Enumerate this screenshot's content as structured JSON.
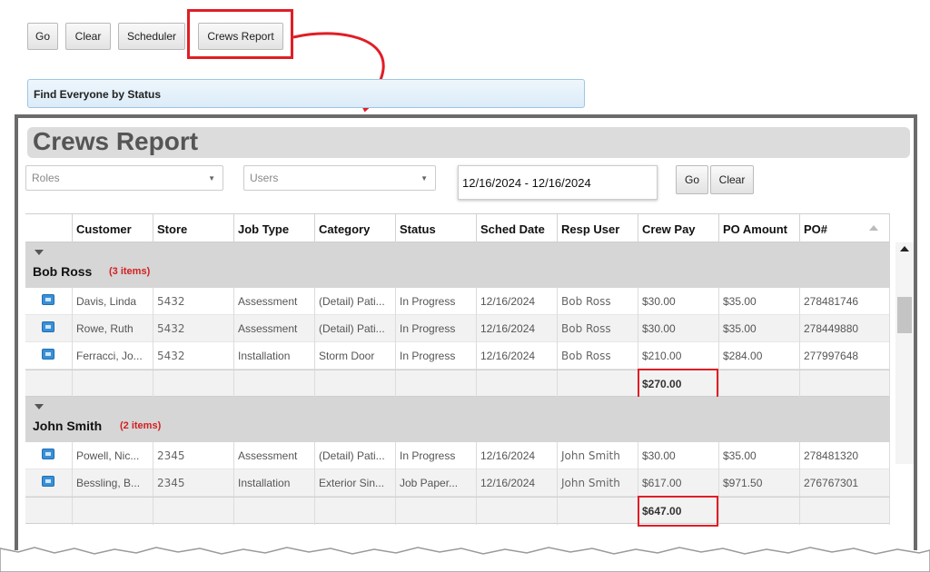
{
  "toolbar": {
    "go": "Go",
    "clear": "Clear",
    "scheduler": "Scheduler",
    "crews_report": "Crews Report"
  },
  "status_bar": {
    "label": "Find Everyone by Status"
  },
  "report": {
    "title": "Crews Report",
    "filters": {
      "roles_placeholder": "Roles",
      "users_placeholder": "Users",
      "date_range": "12/16/2024 - 12/16/2024",
      "go": "Go",
      "clear": "Clear"
    },
    "columns": [
      "Customer",
      "Store",
      "Job Type",
      "Category",
      "Status",
      "Sched Date",
      "Resp User",
      "Crew Pay",
      "PO Amount",
      "PO#"
    ],
    "groups": [
      {
        "name": "Bob Ross",
        "count": "(3 items)",
        "rows": [
          [
            "Davis, Linda",
            "5432",
            "Assessment",
            "(Detail) Pati...",
            "In Progress",
            "12/16/2024",
            "Bob Ross",
            "$30.00",
            "$35.00",
            "278481746"
          ],
          [
            "Rowe, Ruth",
            "5432",
            "Assessment",
            "(Detail) Pati...",
            "In Progress",
            "12/16/2024",
            "Bob Ross",
            "$30.00",
            "$35.00",
            "278449880"
          ],
          [
            "Ferracci, Jo...",
            "5432",
            "Installation",
            "Storm Door",
            "In Progress",
            "12/16/2024",
            "Bob Ross",
            "$210.00",
            "$284.00",
            "277997648"
          ]
        ],
        "total": "$270.00"
      },
      {
        "name": "John Smith",
        "count": "(2 items)",
        "rows": [
          [
            "Powell, Nic...",
            "2345",
            "Assessment",
            "(Detail) Pati...",
            "In Progress",
            "12/16/2024",
            "John Smith",
            "$30.00",
            "$35.00",
            "278481320"
          ],
          [
            "Bessling, B...",
            "2345",
            "Installation",
            "Exterior Sin...",
            "Job Paper...",
            "12/16/2024",
            "John Smith",
            "$617.00",
            "$971.50",
            "276767301"
          ]
        ],
        "total": "$647.00"
      }
    ]
  },
  "colors": {
    "highlight": "#e01e26",
    "group_count": "#d21f1f",
    "title": "#555555"
  },
  "icons": {
    "row_icon": "details-icon",
    "group_toggle": "collapse-triangle-icon"
  }
}
